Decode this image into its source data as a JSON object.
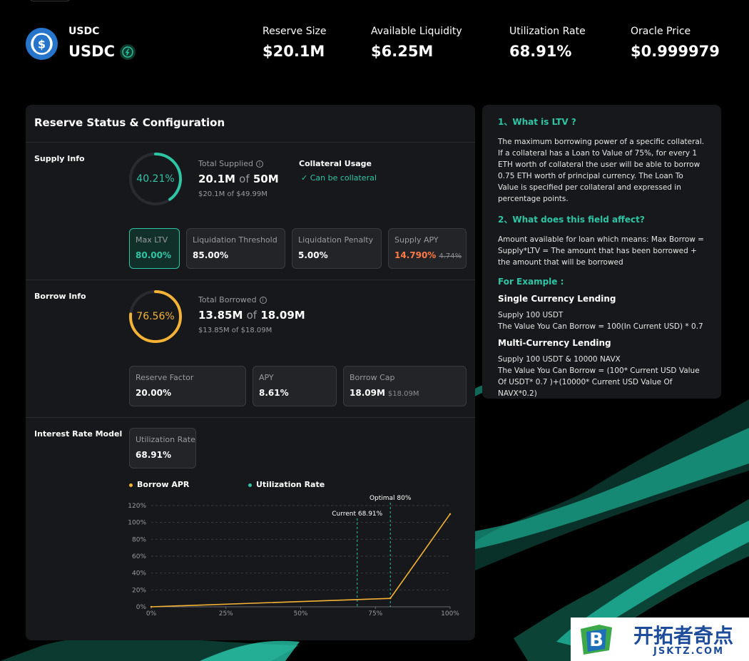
{
  "token": {
    "symbol_small": "USDC",
    "symbol_big": "USDC",
    "logo_icon": "usdc-dollar-icon",
    "logo_color": "#2775ca"
  },
  "stats": [
    {
      "label": "Reserve Size",
      "value": "$20.1M"
    },
    {
      "label": "Available Liquidity",
      "value": "$6.25M"
    },
    {
      "label": "Utilization Rate",
      "value": "68.91%"
    },
    {
      "label": "Oracle Price",
      "value": "$0.999979"
    }
  ],
  "colors": {
    "accent": "#2ec5a5",
    "borrow": "#f5b335",
    "warning": "#ff7a45",
    "panel": "#17181b"
  },
  "main": {
    "title": "Reserve Status & Configuration",
    "supply": {
      "label": "Supply Info",
      "percent_text": "40.21%",
      "percent": 40.21,
      "total_label": "Total Supplied",
      "total_value": "20.1M",
      "of": "of",
      "total_cap": "50M",
      "total_sub": "$20.1M of $49.99M",
      "collateral_title": "Collateral Usage",
      "collateral_status": "Can be collateral",
      "cards": [
        {
          "label": "Max LTV",
          "value": "80.00%"
        },
        {
          "label": "Liquidation Threshold",
          "value": "85.00%"
        },
        {
          "label": "Liquidation Penalty",
          "value": "5.00%"
        },
        {
          "label": "Supply APY",
          "value": "14.790%",
          "value_old": "4.74%"
        }
      ]
    },
    "borrow": {
      "label": "Borrow Info",
      "percent_text": "76.56%",
      "percent": 76.56,
      "total_label": "Total Borrowed",
      "total_value": "13.85M",
      "of": "of",
      "total_cap": "18.09M",
      "total_sub": "$13.85M of $18.09M",
      "cards": [
        {
          "label": "Reserve Factor",
          "value": "20.00%"
        },
        {
          "label": "APY",
          "value": "8.61%"
        },
        {
          "label": "Borrow Cap",
          "value": "18.09M",
          "value_sub": "$18.09M"
        }
      ]
    },
    "interest": {
      "label": "Interest Rate Model",
      "util_label": "Utilization Rate",
      "util_value": "68.91%",
      "legend_borrow": "Borrow APR",
      "legend_util": "Utilization Rate"
    }
  },
  "chart_data": {
    "type": "line",
    "series": [
      {
        "name": "Borrow APR",
        "x": [
          0,
          80,
          100
        ],
        "y": [
          0,
          10,
          110
        ]
      }
    ],
    "markers": [
      {
        "label": "Current 68.91%",
        "x": 68.91
      },
      {
        "label": "Optimal 80%",
        "x": 80
      }
    ],
    "xticks": [
      "0%",
      "25%",
      "50%",
      "75%",
      "100%"
    ],
    "yticks": [
      "0%",
      "20%",
      "40%",
      "60%",
      "80%",
      "100%",
      "120%"
    ],
    "xlim": [
      0,
      100
    ],
    "ylim": [
      0,
      120
    ],
    "grid": true
  },
  "faq": {
    "q1": "1、What is LTV ?",
    "a1": "The maximum borrowing power of a specific collateral. If a collateral has a Loan to Value of 75%, for every 1 ETH worth of collateral the user will be able to borrow 0.75 ETH worth of principal currency. The Loan To Value is specified per collateral and expressed in percentage points.",
    "q2": "2、What does this field affect?",
    "a2": "Amount available for loan which means: Max Borrow = Supply*LTV = The amount that has been borrowed + the amount that will be borrowed",
    "example_title": "For Example :",
    "ex1_title": "Single Currency Lending",
    "ex1_line1": "Supply 100 USDT",
    "ex1_line2": "The Value You Can Borrow = 100(In Current USD) * 0.7",
    "ex2_title": "Multi-Currency Lending",
    "ex2_line1": "Supply 100 USDT & 10000 NAVX",
    "ex2_line2": "The Value You Can Borrow = (100* Current USD Value Of USDT* 0.7 )+(10000* Current USD Value Of NAVX*0.2)"
  },
  "watermark": {
    "cn": "开拓者奇点",
    "en": "JSKTZ.COM",
    "logo_letter": "B"
  }
}
